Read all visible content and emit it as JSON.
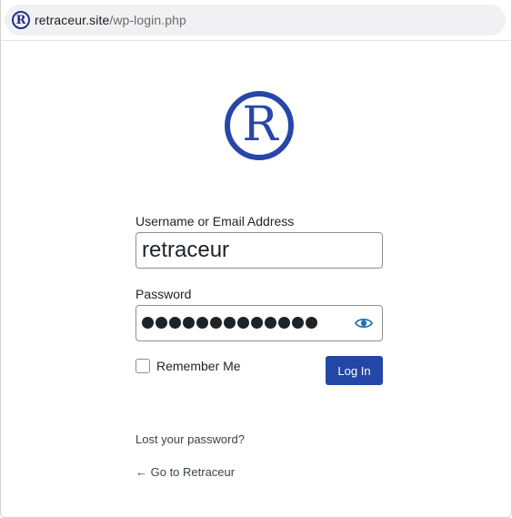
{
  "browser": {
    "url_host": "retraceur.site",
    "url_path": "/wp-login.php",
    "favicon_glyph": "R"
  },
  "logo": {
    "glyph": "R",
    "color": "#2747a8"
  },
  "form": {
    "username_label": "Username or Email Address",
    "username_value": "retraceur",
    "password_label": "Password",
    "password_masked_length": 13,
    "remember_label": "Remember Me",
    "remember_checked": false,
    "login_button": "Log In"
  },
  "links": {
    "lost_password": "Lost your password?",
    "back_to_site": "← Go to Retraceur"
  },
  "colors": {
    "accent": "#2247a7",
    "text": "#1d2327",
    "border": "#8c8f94"
  },
  "icons": {
    "show_password": "eye-icon"
  }
}
